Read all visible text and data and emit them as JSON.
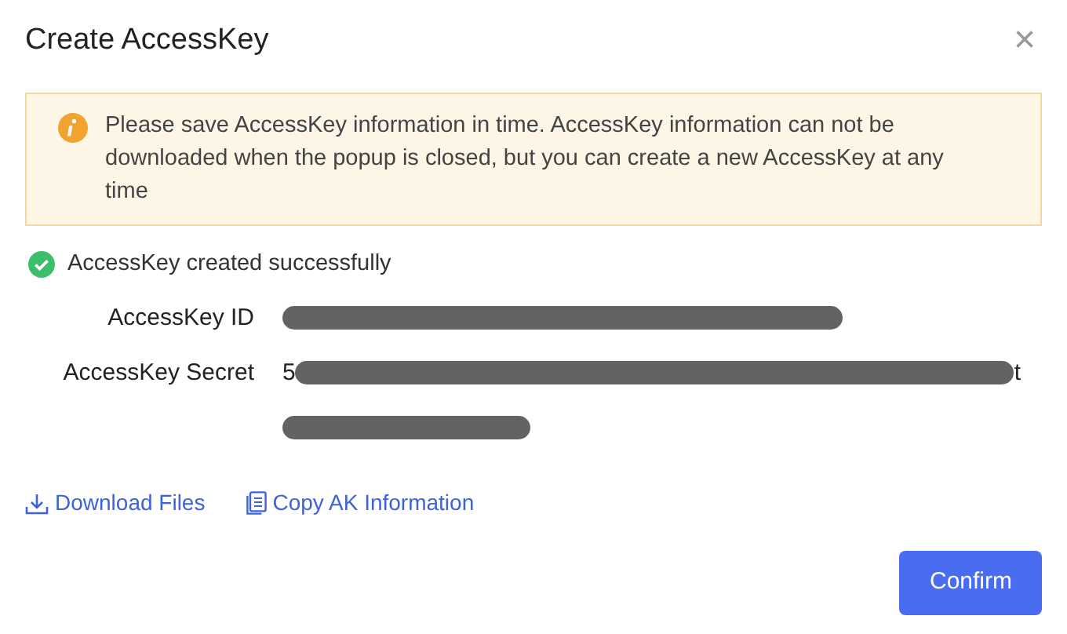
{
  "dialog": {
    "title": "Create AccessKey",
    "close": "×"
  },
  "alert": {
    "kind": "warning",
    "text": "Please save AccessKey information in time. AccessKey information can not be downloaded when the popup is closed, but you can create a new AccessKey at any time"
  },
  "status": {
    "kind": "success",
    "text": "AccessKey created successfully"
  },
  "fields": [
    {
      "label": "AccessKey ID",
      "lines": [
        {
          "redacted": true
        }
      ]
    },
    {
      "label": "AccessKey Secret",
      "lines": [
        {
          "visible_start": "5",
          "redacted": true,
          "visible_end": "t"
        },
        {
          "redacted": true
        }
      ]
    }
  ],
  "links": [
    {
      "kind": "download",
      "label": "Download Files"
    },
    {
      "kind": "copy",
      "label": "Copy AK Information"
    }
  ],
  "buttons": [
    {
      "label": "Confirm"
    }
  ]
}
